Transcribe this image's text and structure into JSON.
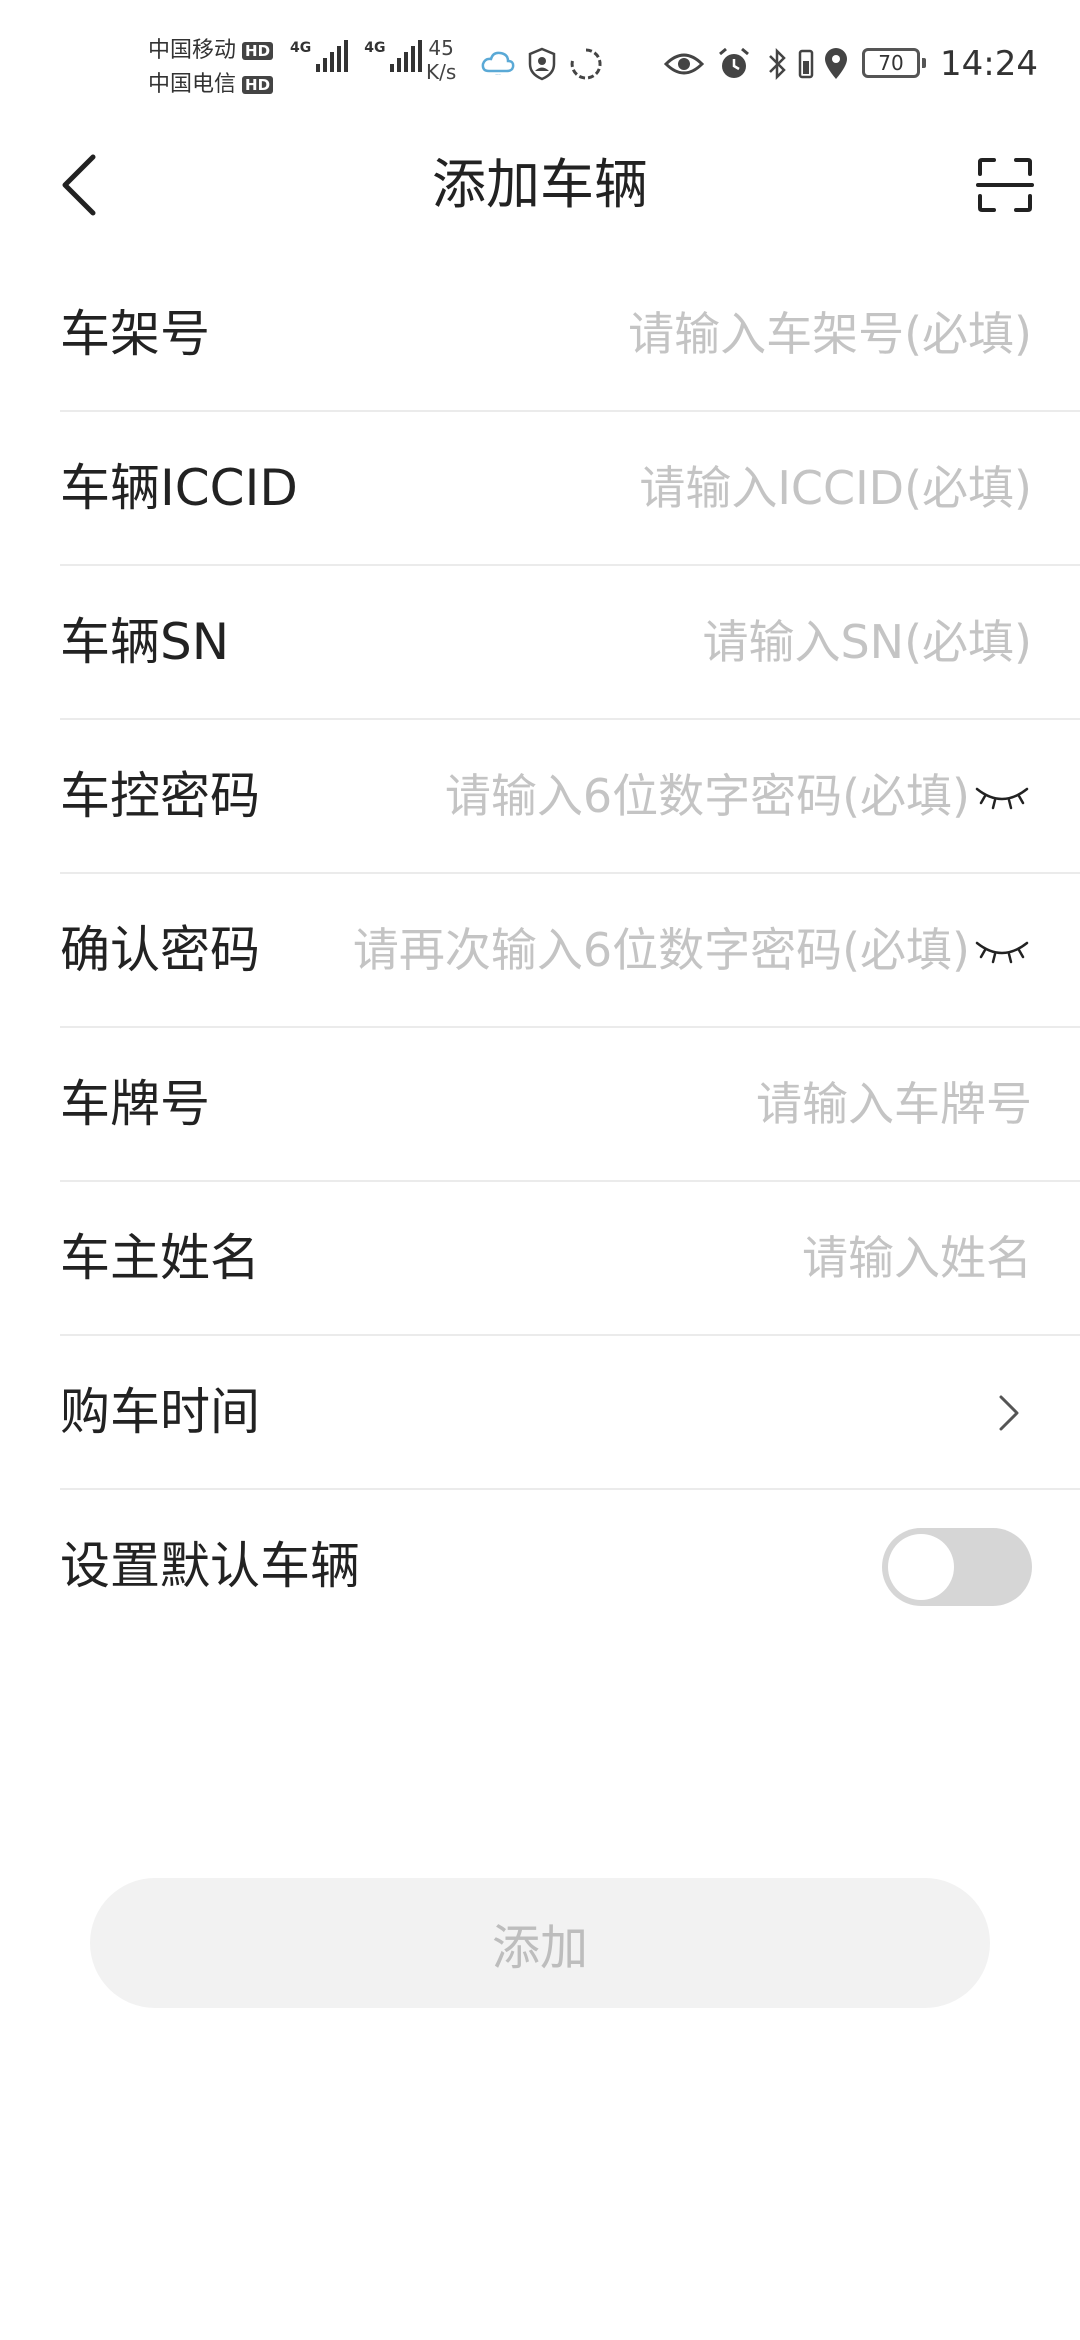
{
  "status_bar": {
    "carriers": [
      {
        "name": "中国移动",
        "badge": "HD"
      },
      {
        "name": "中国电信",
        "badge": "HD"
      }
    ],
    "network_types": [
      "4G",
      "4G"
    ],
    "speed_value": "45",
    "speed_unit": "K/s",
    "battery": "70",
    "time": "14:24",
    "icons": [
      "cloud-icon",
      "shield-icon",
      "loading-icon",
      "eye-icon",
      "alarm-icon",
      "bluetooth-icon",
      "phone-vibrate-icon",
      "location-icon"
    ]
  },
  "nav": {
    "title": "添加车辆",
    "back_icon": "back-arrow-icon",
    "scan_icon": "scan-icon"
  },
  "form": {
    "vin": {
      "label": "车架号",
      "placeholder": "请输入车架号(必填)",
      "value": ""
    },
    "iccid": {
      "label": "车辆ICCID",
      "placeholder": "请输入ICCID(必填)",
      "value": ""
    },
    "sn": {
      "label": "车辆SN",
      "placeholder": "请输入SN(必填)",
      "value": ""
    },
    "password": {
      "label": "车控密码",
      "placeholder": "请输入6位数字密码(必填)",
      "value": "",
      "icon": "eye-closed-icon"
    },
    "confirm_password": {
      "label": "确认密码",
      "placeholder": "请再次输入6位数字密码(必填)",
      "value": "",
      "icon": "eye-closed-icon"
    },
    "plate": {
      "label": "车牌号",
      "placeholder": "请输入车牌号",
      "value": ""
    },
    "owner_name": {
      "label": "车主姓名",
      "placeholder": "请输入姓名",
      "value": ""
    },
    "purchase_time": {
      "label": "购车时间",
      "icon": "chevron-right-icon"
    },
    "default_vehicle": {
      "label": "设置默认车辆",
      "enabled": false
    }
  },
  "submit": {
    "label": "添加"
  },
  "colors": {
    "text": "#222222",
    "placeholder": "#c4c4c4",
    "divider": "#ebebeb",
    "toggle_off": "#d6d6d6",
    "button_bg": "#f2f2f2",
    "button_text": "#bdbdbd"
  }
}
